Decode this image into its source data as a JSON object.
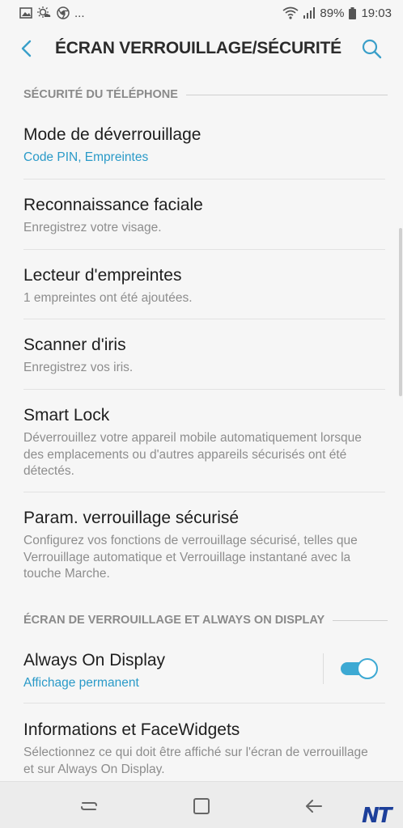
{
  "statusbar": {
    "battery": "89%",
    "time": "19:03",
    "more": "..."
  },
  "appbar": {
    "title": "ÉCRAN VERROUILLAGE/SÉCURITÉ"
  },
  "sections": {
    "phone_security": "SÉCURITÉ DU TÉLÉPHONE",
    "lockscreen": "ÉCRAN DE VERROUILLAGE ET ALWAYS ON DISPLAY"
  },
  "items": [
    {
      "title": "Mode de déverrouillage",
      "subtitle": "Code PIN, Empreintes"
    },
    {
      "title": "Reconnaissance faciale",
      "subtitle": "Enregistrez votre visage."
    },
    {
      "title": "Lecteur d'empreintes",
      "subtitle": "1 empreintes ont été ajoutées."
    },
    {
      "title": "Scanner d'iris",
      "subtitle": "Enregistrez vos iris."
    },
    {
      "title": "Smart Lock",
      "subtitle": "Déverrouillez votre appareil mobile automatiquement lorsque des emplacements ou d'autres appareils sécurisés ont été détectés."
    },
    {
      "title": "Param. verrouillage sécurisé",
      "subtitle": "Configurez vos fonctions de verrouillage sécurisé, telles que Verrouillage automatique et Verrouillage instantané avec la touche Marche."
    },
    {
      "title": "Always On Display",
      "subtitle": "Affichage permanent",
      "toggle_on": true
    },
    {
      "title": "Informations et FaceWidgets",
      "subtitle": "Sélectionnez ce qui doit être affiché sur l'écran de verrouillage et sur Always On Display."
    }
  ],
  "colors": {
    "accent": "#2a9ac8",
    "toggle": "#3da9d3",
    "background": "#f6f6f6"
  },
  "watermark": "NT"
}
